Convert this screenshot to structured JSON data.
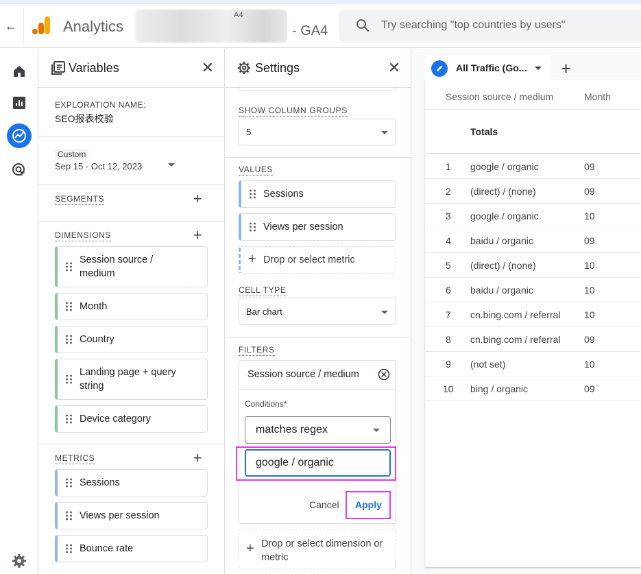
{
  "header": {
    "back_icon": "arrow-left-icon",
    "app_name": "Analytics",
    "account_small": "A4",
    "property_name": "- GA4",
    "search_placeholder": "Try searching \"top countries by users\""
  },
  "rail": {
    "icons": [
      "home-icon",
      "reports-icon",
      "explore-icon",
      "advertising-icon",
      "settings-gear-icon"
    ]
  },
  "variables": {
    "title": "Variables",
    "exploration_label": "EXPLORATION NAME:",
    "exploration_name": "SEO报表校验",
    "date_badge": "Custom",
    "date_range": "Sep 15 - Oct 12, 2023",
    "segments_label": "SEGMENTS",
    "dimensions_label": "DIMENSIONS",
    "dimensions": [
      "Session source / medium",
      "Month",
      "Country",
      "Landing page + query string",
      "Device category"
    ],
    "metrics_label": "METRICS",
    "metrics": [
      "Sessions",
      "Views per session",
      "Bounce rate"
    ]
  },
  "settings": {
    "title": "Settings",
    "show_column_groups_label": "SHOW COLUMN GROUPS",
    "show_column_groups_value": "5",
    "values_label": "VALUES",
    "values": [
      "Sessions",
      "Views per session"
    ],
    "drop_metric": "Drop or select metric",
    "cell_type_label": "CELL TYPE",
    "cell_type_value": "Bar chart",
    "filters_label": "FILTERS",
    "filter_dimension": "Session source / medium",
    "conditions_label": "Conditions*",
    "condition_value": "matches regex",
    "filter_input_value": "google / organic",
    "cancel_label": "Cancel",
    "apply_label": "Apply",
    "drop_dimension": "Drop or select dimension or metric"
  },
  "table": {
    "tab_label": "All Traffic (Go...",
    "col_source": "Session source / medium",
    "col_month": "Month",
    "totals_label": "Totals",
    "rows": [
      {
        "n": "1",
        "source": "google / organic",
        "month": "09"
      },
      {
        "n": "2",
        "source": "(direct) / (none)",
        "month": "09"
      },
      {
        "n": "3",
        "source": "google / organic",
        "month": "10"
      },
      {
        "n": "4",
        "source": "baidu / organic",
        "month": "09"
      },
      {
        "n": "5",
        "source": "(direct) / (none)",
        "month": "10"
      },
      {
        "n": "6",
        "source": "baidu / organic",
        "month": "10"
      },
      {
        "n": "7",
        "source": "cn.bing.com / referral",
        "month": "10"
      },
      {
        "n": "8",
        "source": "cn.bing.com / referral",
        "month": "09"
      },
      {
        "n": "9",
        "source": "(not set)",
        "month": "10"
      },
      {
        "n": "10",
        "source": "bing / organic",
        "month": "09"
      }
    ]
  },
  "colors": {
    "accent": "#1a73e8",
    "dimension_bar": "#81c995",
    "metric_bar": "#8ab4f8",
    "highlight": "#e03ce3"
  }
}
